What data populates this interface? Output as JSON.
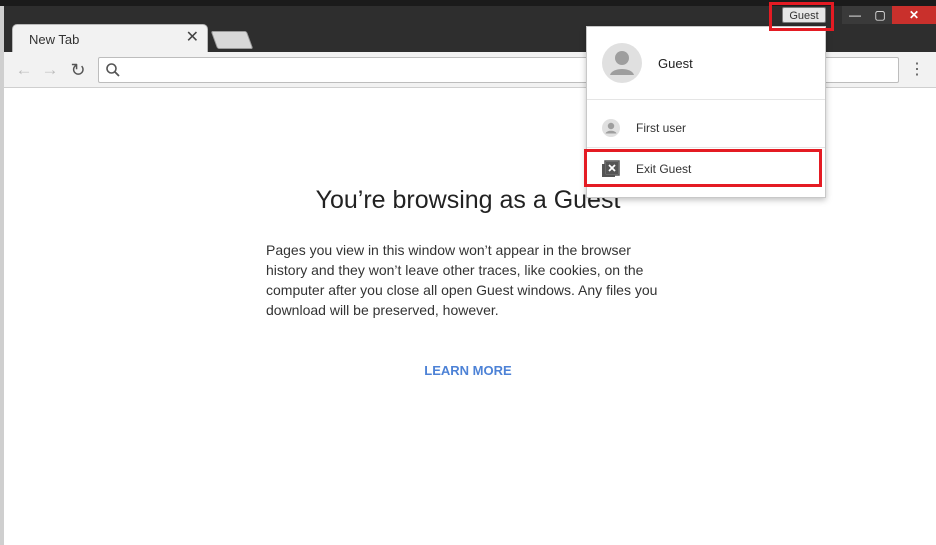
{
  "window": {
    "guest_chip_label": "Guest",
    "controls": {
      "minimize": "—",
      "maximize": "▢",
      "close": "✕"
    }
  },
  "tabs": [
    {
      "title": "New Tab",
      "close_glyph": "✕"
    }
  ],
  "toolbar": {
    "back_glyph": "←",
    "forward_glyph": "→",
    "reload_glyph": "↻",
    "omnibox_value": "",
    "menu_glyph": "⋮"
  },
  "page": {
    "title": "You’re browsing as a Guest",
    "body": "Pages you view in this window won’t appear in the browser history and they won’t leave other traces, like cookies, on the computer after you close all open Guest windows. Any files you download will be preserved, however.",
    "learn_more": "LEARN MORE"
  },
  "profile_menu": {
    "current_profile": "Guest",
    "items": [
      {
        "label": "First user",
        "icon": "person-icon"
      },
      {
        "label": "Exit Guest",
        "icon": "exit-guest-icon"
      }
    ]
  },
  "colors": {
    "highlight": "#e41b23",
    "link": "#4d82d6",
    "close_button": "#c9302c"
  }
}
